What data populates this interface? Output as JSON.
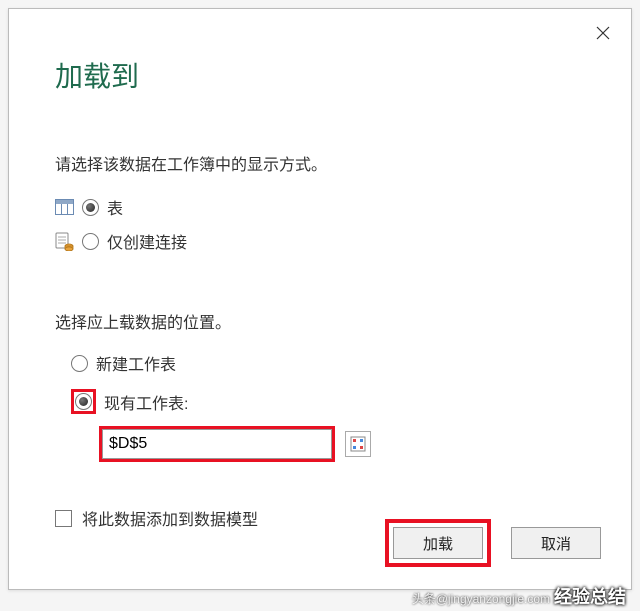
{
  "dialog": {
    "title": "加载到",
    "instruction": "请选择该数据在工作簿中的显示方式。",
    "options": {
      "table": "表",
      "connection_only": "仅创建连接"
    },
    "location": {
      "heading": "选择应上载数据的位置。",
      "new_sheet": "新建工作表",
      "existing_sheet": "现有工作表:",
      "cell_value": "$D$5"
    },
    "add_to_model": "将此数据添加到数据模型",
    "buttons": {
      "load": "加载",
      "cancel": "取消"
    }
  },
  "watermark": {
    "main": "经验总结",
    "sub": "头条@jingyanzongjie.com"
  }
}
